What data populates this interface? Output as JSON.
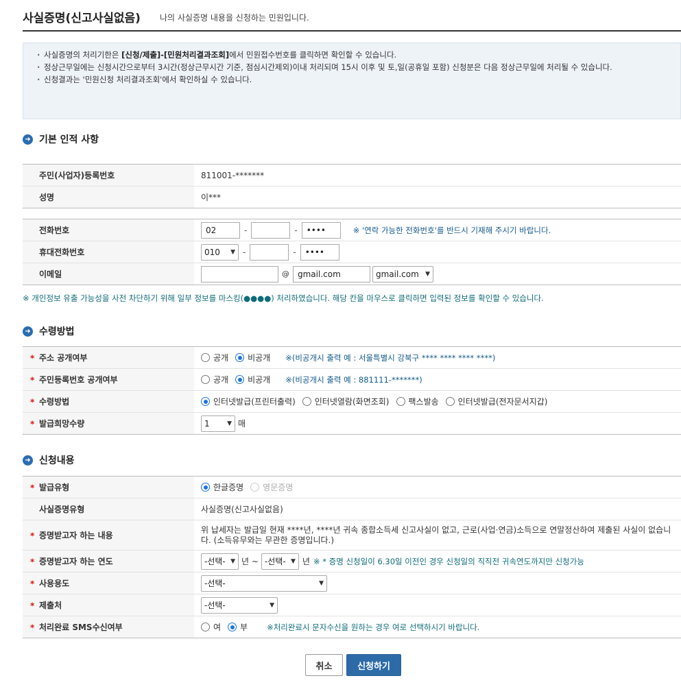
{
  "header": {
    "title": "사실증명(신고사실없음)",
    "subtitle": "나의 사실증명 내용을 신청하는 민원입니다."
  },
  "notice": {
    "l1_pre": "사실증명의 처리기한은 ",
    "l1_bold": "[신청/제출]-[민원처리결과조회]",
    "l1_post": "에서 민원접수번호를 클릭하면 확인할 수 있습니다.",
    "l2": "정상근무일에는 신청시간으로부터 3시간(정상근무시간 기준, 점심시간제외)이내 처리되며 15시 이후 및 토,일(공휴일 포함) 신청분은 다음 정상근무일에 처리될 수 있습니다.",
    "l3": "신청결과는 '민원신청 처리결과조회'에서 확인하실 수 있습니다."
  },
  "basic": {
    "section_title": "기본 인적 사항",
    "rrn_label": "주민(사업자)등록번호",
    "rrn_value": "811001-*******",
    "name_label": "성명",
    "name_value": "이***"
  },
  "contact": {
    "phone_label": "전화번호",
    "phone_1": "02",
    "phone_2": "",
    "phone_3": "••••",
    "phone_note": "※ '연락 가능한 전화번호'를 반드시 기재해 주시기 바랍니다.",
    "mobile_label": "휴대전화번호",
    "mobile_1": "010",
    "mobile_2": "",
    "mobile_3": "••••",
    "email_label": "이메일",
    "email_id": "",
    "at": "@",
    "email_domain": "gmail.com",
    "email_domain_select": "gmail.com",
    "mask_note": "※ 개인정보 유출 가능성을 사전 차단하기 위해 일부 정보를 마스킹(●●●●) 처리하였습니다. 해당 칸을 마우스로 클릭하면 입력된 정보를 확인할 수 있습니다."
  },
  "receive": {
    "section_title": "수령방법",
    "addr_label": "주소 공개여부",
    "addr_public": "공개",
    "addr_private": "비공개",
    "addr_note": "※(비공개시 출력 예 : 서울특별시 강북구 **** **** **** ****)",
    "rrn_label": "주민등록번호 공개여부",
    "rrn_public": "공개",
    "rrn_private": "비공개",
    "rrn_note": "※(비공개시 출력 예 : 881111-*******)",
    "method_label": "수령방법",
    "method_1": "인터넷발급(프린터출력)",
    "method_2": "인터넷열람(화면조회)",
    "method_3": "팩스발송",
    "method_4": "인터넷발급(전자문서지갑)",
    "qty_label": "발급희망수량",
    "qty_value": "1",
    "qty_unit": "매"
  },
  "request": {
    "section_title": "신청내용",
    "type_label": "발급유형",
    "type_kor": "한글증명",
    "type_eng": "영문증명",
    "cert_type_label": "사실증명유형",
    "cert_type_value": "사실증명(신고사실없음)",
    "content_label": "증명받고자 하는 내용",
    "content_value": "위 납세자는 발급일 현재 ****년, ****년 귀속 종합소득세 신고사실이 없고, 근로(사업·연금)소득으로 연말정산하여 제출된 사실이 없습니다. (소득유무와는 무관한 증명입니다.)",
    "year_label": "증명받고자 하는 연도",
    "year_from": "-선택-",
    "year_unit1": "년 ~",
    "year_to": "-선택-",
    "year_unit2": "년",
    "year_note": "※ * 증명 신청일이 6.30일 이전인 경우 신청일의 직직전 귀속연도까지만 신청가능",
    "use_label": "사용용도",
    "use_value": "-선택-",
    "submit_to_label": "제출처",
    "submit_to_value": "-선택-",
    "sms_label": "처리완료 SMS수신여부",
    "sms_yes": "여",
    "sms_no": "부",
    "sms_note": "※처리완료시 문자수신을 원하는 경우 여로 선택하시기 바랍니다."
  },
  "buttons": {
    "cancel": "취소",
    "submit": "신청하기"
  },
  "colors": {
    "accent": "#2d6aa8",
    "required": "#dd1111",
    "note": "#0f6c7a"
  }
}
